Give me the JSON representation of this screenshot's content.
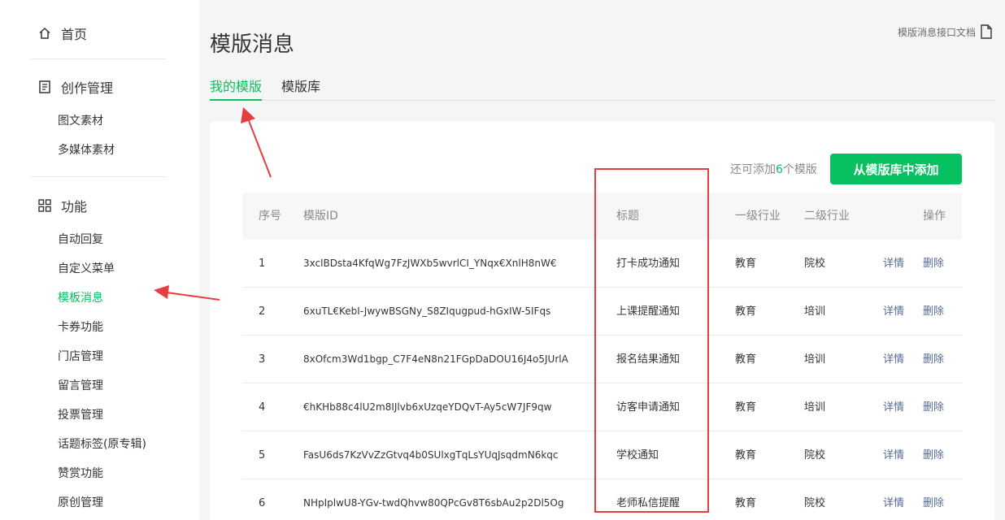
{
  "sidebar": {
    "home": "首页",
    "create": {
      "title": "创作管理",
      "items": [
        "图文素材",
        "多媒体素材"
      ]
    },
    "features": {
      "title": "功能",
      "items": [
        {
          "label": "自动回复",
          "active": false
        },
        {
          "label": "自定义菜单",
          "active": false
        },
        {
          "label": "模板消息",
          "active": true
        },
        {
          "label": "卡券功能",
          "active": false
        },
        {
          "label": "门店管理",
          "active": false
        },
        {
          "label": "留言管理",
          "active": false
        },
        {
          "label": "投票管理",
          "active": false
        },
        {
          "label": "话题标签(原专辑)",
          "active": false
        },
        {
          "label": "赞赏功能",
          "active": false
        },
        {
          "label": "原创管理",
          "active": false
        }
      ]
    }
  },
  "main": {
    "title": "模版消息",
    "doc_link": "模版消息接口文档",
    "tabs": [
      {
        "label": "我的模版",
        "active": true
      },
      {
        "label": "模版库",
        "active": false
      }
    ],
    "remain_prefix": "还可添加",
    "remain_count": "6",
    "remain_suffix": "个模版",
    "add_button": "从模版库中添加",
    "table": {
      "headers": [
        "序号",
        "模版ID",
        "标题",
        "一级行业",
        "二级行业",
        "操作"
      ],
      "rows": [
        {
          "no": "1",
          "id": "3xclBDsta4KfqWg7FzJWXb5wvrlCI_YNqx€XnlH8nW€",
          "title": "打卡成功通知",
          "ind1": "教育",
          "ind2": "院校",
          "detail": "详情",
          "delete": "删除"
        },
        {
          "no": "2",
          "id": "6xuTL€KebI-JwywBSGNy_S8ZIqugpud-hGxIW-5IFqs",
          "title": "上课提醒通知",
          "ind1": "教育",
          "ind2": "培训",
          "detail": "详情",
          "delete": "删除"
        },
        {
          "no": "3",
          "id": "8xOfcm3Wd1bgp_C7F4eN8n21FGpDaDOU16J4o5JUrlA",
          "title": "报名结果通知",
          "ind1": "教育",
          "ind2": "培训",
          "detail": "详情",
          "delete": "删除"
        },
        {
          "no": "4",
          "id": "€hKHb88c4lU2m8IJlvb6xUzqeYDQvT-Ay5cW7JF9qw",
          "title": "访客申请通知",
          "ind1": "教育",
          "ind2": "培训",
          "detail": "详情",
          "delete": "删除"
        },
        {
          "no": "5",
          "id": "FasU6ds7KzVvZzGtvq4b0SUlxgTqLsYUqJsqdmN6kqc",
          "title": "学校通知",
          "ind1": "教育",
          "ind2": "院校",
          "detail": "详情",
          "delete": "删除"
        },
        {
          "no": "6",
          "id": "NHpIplwU8-YGv-twdQhvw80QPcGv8T6sbAu2p2Dl5Og",
          "title": "老师私信提醒",
          "ind1": "教育",
          "ind2": "院校",
          "detail": "详情",
          "delete": "删除"
        }
      ]
    }
  },
  "colors": {
    "accent": "#07c160",
    "link": "#576b95",
    "annotation": "#e53e3e"
  },
  "icons": {
    "home": "home-icon",
    "create": "document-icon",
    "features": "grid-icon",
    "doc": "file-icon"
  }
}
